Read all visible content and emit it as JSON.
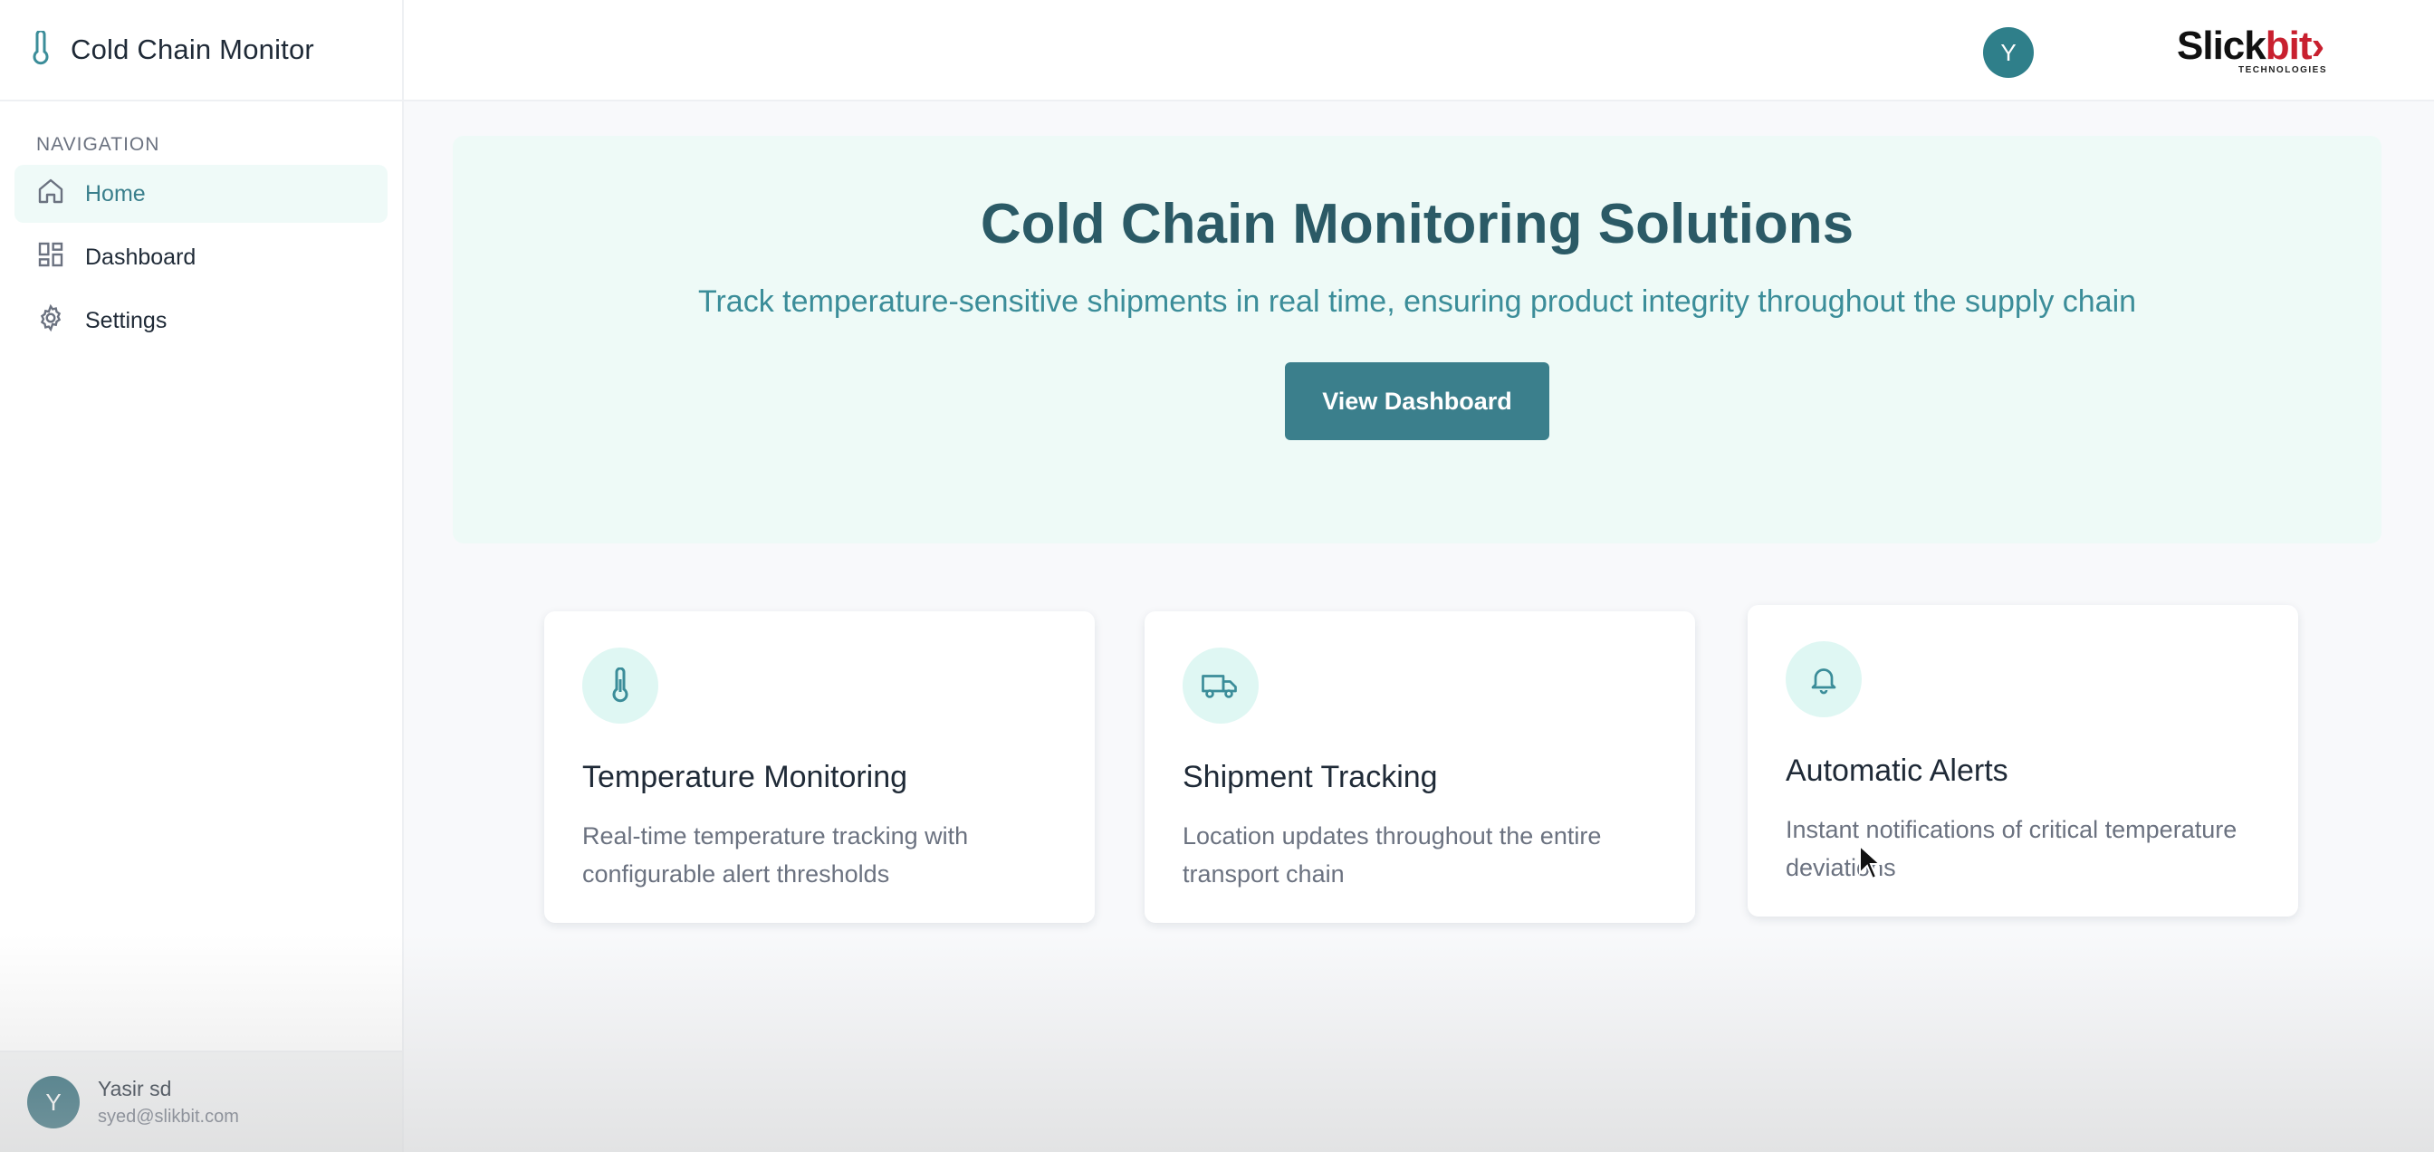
{
  "app": {
    "title": "Cold Chain Monitor"
  },
  "sidebar": {
    "section_label": "NAVIGATION",
    "items": [
      {
        "label": "Home",
        "icon": "home-icon",
        "active": true
      },
      {
        "label": "Dashboard",
        "icon": "dashboard-icon",
        "active": false
      },
      {
        "label": "Settings",
        "icon": "gear-icon",
        "active": false
      }
    ],
    "user": {
      "initial": "Y",
      "name": "Yasir sd",
      "email": "syed@slikbit.com"
    }
  },
  "topbar": {
    "logo_text_black": "Slick",
    "logo_text_red": "bit",
    "logo_subtext": "TECHNOLOGIES",
    "avatar_initial": "Y"
  },
  "hero": {
    "title": "Cold Chain Monitoring Solutions",
    "subtitle": "Track temperature-sensitive shipments in real time, ensuring product integrity throughout the supply chain",
    "cta_label": "View Dashboard"
  },
  "features": [
    {
      "icon": "thermometer-icon",
      "title": "Temperature Monitoring",
      "description": "Real-time temperature tracking with configurable alert thresholds"
    },
    {
      "icon": "truck-icon",
      "title": "Shipment Tracking",
      "description": "Location updates throughout the entire transport chain"
    },
    {
      "icon": "bell-icon",
      "title": "Automatic Alerts",
      "description": "Instant notifications of critical temperature deviations"
    }
  ],
  "colors": {
    "accent": "#3b7f8c",
    "hero_bg": "#eefaf7",
    "title": "#2b5a66",
    "brand_red": "#c8202f"
  }
}
